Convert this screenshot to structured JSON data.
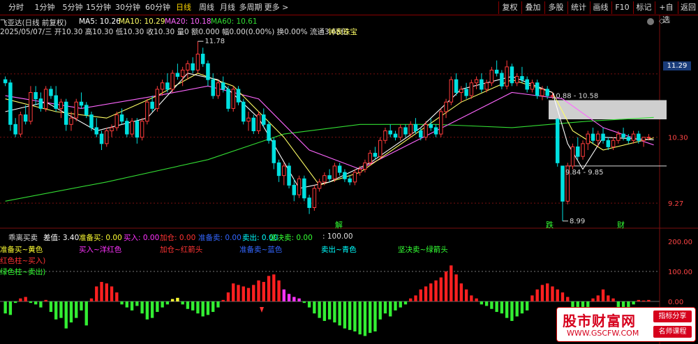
{
  "toolbar": {
    "periods": [
      "分时",
      "1分钟",
      "5分钟",
      "15分钟",
      "30分钟",
      "60分钟",
      "日线",
      "周线",
      "月线",
      "多周期",
      "更多 >"
    ],
    "active_period": "日线",
    "right_buttons": [
      "复权",
      "叠加",
      "多股",
      "统计",
      "画线",
      "F10",
      "标记",
      "+自选",
      "返回"
    ]
  },
  "info": {
    "stock_title": "飞亚达(日线 前复权)",
    "ma5": "MA5: 10.26",
    "ma10": "MA10: 10.29",
    "ma20": "MA20: 10.18",
    "ma60": "MA60: 10.61",
    "date_line": "2025/05/07/三 开10.30 高10.30 低10.30 收10.30 量0 额0.000 幅0.00(0.00%) 换0.00% 流通3.65亿",
    "industry": "钟表珠宝"
  },
  "price_axis": {
    "labels": [
      "11.29",
      "10.30",
      "9.27"
    ]
  },
  "price_annotations": [
    "11.78",
    "10.88 - 10.58",
    "9.84 - 9.85",
    "8.99"
  ],
  "event_markers": [
    "解",
    "跌",
    "财"
  ],
  "indicator": {
    "name": "乖离买卖",
    "chadiff": "差值: 3.40",
    "zhunbeimai": "准备买: 0.00",
    "mairu": "买入: 0.00",
    "jiacang": "加仓: 0.00",
    "zhunbeimai2": "准备卖: 0.00",
    "maichu": "卖出: 0.00",
    "jianjuemai": "坚决卖: 0.00",
    "hundred": ": 100.00",
    "legend": [
      "准备买~黄色",
      "买入~洋红色",
      "加仓~红箭头",
      "准备卖~蓝色",
      "卖出~青色",
      "坚决卖~绿箭头"
    ],
    "legend2": [
      "红色柱~买入)",
      "绿色柱~卖出)"
    ],
    "axis_labels": [
      "200.00",
      "100.00",
      "0.00"
    ]
  },
  "colors": {
    "up": "#ff3b3b",
    "down": "#00e0e0",
    "ma5": "#ffffff",
    "ma10": "#ffff66",
    "ma20": "#ff66ff",
    "ma60": "#33dd33",
    "grid": "#7a1010"
  },
  "watermark": {
    "title": "股市财富网",
    "url": "WWW.GSCFW.COM",
    "tag1": "指标分享",
    "tag2": "名师课程"
  },
  "chart_data": {
    "type": "candlestick",
    "y_range": [
      8.9,
      11.9
    ],
    "candles": [
      [
        11.2,
        11.25,
        11.1,
        11.15
      ],
      [
        11.15,
        11.2,
        10.4,
        10.5
      ],
      [
        10.5,
        10.6,
        10.3,
        10.35
      ],
      [
        10.35,
        10.7,
        10.3,
        10.65
      ],
      [
        10.65,
        10.8,
        10.5,
        10.55
      ],
      [
        10.55,
        11.1,
        10.5,
        11.0
      ],
      [
        11.0,
        11.1,
        10.8,
        10.9
      ],
      [
        10.9,
        11.0,
        10.7,
        10.75
      ],
      [
        10.75,
        11.1,
        10.7,
        11.05
      ],
      [
        11.05,
        11.1,
        10.9,
        10.95
      ],
      [
        10.95,
        11.1,
        10.7,
        10.75
      ],
      [
        10.75,
        10.9,
        10.6,
        10.85
      ],
      [
        10.85,
        10.9,
        10.4,
        10.5
      ],
      [
        10.5,
        10.7,
        10.4,
        10.6
      ],
      [
        10.6,
        10.9,
        10.55,
        10.85
      ],
      [
        10.85,
        11.0,
        10.75,
        10.8
      ],
      [
        10.8,
        10.85,
        10.6,
        10.65
      ],
      [
        10.65,
        10.7,
        10.4,
        10.45
      ],
      [
        10.45,
        10.6,
        10.3,
        10.35
      ],
      [
        10.35,
        10.4,
        10.1,
        10.2
      ],
      [
        10.2,
        10.45,
        10.15,
        10.4
      ],
      [
        10.4,
        10.5,
        10.3,
        10.45
      ],
      [
        10.45,
        10.7,
        10.4,
        10.65
      ],
      [
        10.65,
        10.75,
        10.5,
        10.55
      ],
      [
        10.55,
        10.6,
        10.3,
        10.35
      ],
      [
        10.35,
        10.6,
        10.3,
        10.55
      ],
      [
        10.55,
        10.6,
        10.2,
        10.3
      ],
      [
        10.3,
        10.6,
        10.25,
        10.55
      ],
      [
        10.55,
        10.9,
        10.5,
        10.85
      ],
      [
        10.85,
        10.95,
        10.7,
        10.75
      ],
      [
        10.75,
        11.1,
        10.7,
        11.05
      ],
      [
        11.05,
        11.2,
        10.95,
        11.15
      ],
      [
        11.15,
        11.3,
        11.0,
        11.05
      ],
      [
        11.05,
        11.35,
        11.0,
        11.3
      ],
      [
        11.3,
        11.45,
        11.2,
        11.25
      ],
      [
        11.25,
        11.4,
        11.1,
        11.35
      ],
      [
        11.35,
        11.5,
        11.2,
        11.45
      ],
      [
        11.45,
        11.55,
        11.3,
        11.35
      ],
      [
        11.35,
        11.8,
        11.3,
        11.6
      ],
      [
        11.6,
        11.7,
        11.4,
        11.45
      ],
      [
        11.45,
        11.5,
        11.1,
        11.2
      ],
      [
        11.2,
        11.3,
        10.9,
        10.95
      ],
      [
        10.95,
        11.2,
        10.9,
        11.15
      ],
      [
        11.15,
        11.25,
        11.0,
        11.05
      ],
      [
        11.05,
        11.1,
        10.7,
        10.75
      ],
      [
        10.75,
        11.1,
        10.7,
        11.05
      ],
      [
        11.05,
        11.1,
        10.8,
        10.85
      ],
      [
        10.85,
        10.9,
        10.5,
        10.55
      ],
      [
        10.55,
        10.7,
        10.4,
        10.6
      ],
      [
        10.6,
        10.65,
        10.35,
        10.4
      ],
      [
        10.4,
        10.7,
        10.35,
        10.65
      ],
      [
        10.65,
        10.75,
        10.45,
        10.5
      ],
      [
        10.5,
        10.55,
        10.2,
        10.25
      ],
      [
        10.25,
        10.3,
        9.8,
        9.9
      ],
      [
        9.9,
        9.95,
        9.6,
        9.7
      ],
      [
        9.7,
        9.9,
        9.55,
        9.85
      ],
      [
        9.85,
        9.9,
        9.5,
        9.55
      ],
      [
        9.55,
        9.65,
        9.3,
        9.4
      ],
      [
        9.4,
        9.7,
        9.35,
        9.65
      ],
      [
        9.65,
        9.7,
        9.3,
        9.35
      ],
      [
        9.35,
        9.4,
        9.1,
        9.2
      ],
      [
        9.2,
        9.55,
        9.15,
        9.5
      ],
      [
        9.5,
        9.65,
        9.45,
        9.6
      ],
      [
        9.6,
        9.75,
        9.55,
        9.7
      ],
      [
        9.7,
        9.8,
        9.6,
        9.65
      ],
      [
        9.65,
        9.9,
        9.6,
        9.85
      ],
      [
        9.85,
        9.9,
        9.7,
        9.75
      ],
      [
        9.75,
        9.8,
        9.6,
        9.65
      ],
      [
        9.65,
        9.7,
        9.55,
        9.6
      ],
      [
        9.6,
        9.8,
        9.55,
        9.75
      ],
      [
        9.75,
        9.85,
        9.7,
        9.8
      ],
      [
        9.8,
        9.95,
        9.75,
        9.9
      ],
      [
        9.9,
        10.1,
        9.85,
        10.05
      ],
      [
        10.05,
        10.15,
        9.95,
        10.0
      ],
      [
        10.0,
        10.3,
        9.95,
        10.25
      ],
      [
        10.25,
        10.45,
        10.2,
        10.4
      ],
      [
        10.4,
        10.5,
        10.3,
        10.35
      ],
      [
        10.35,
        10.4,
        10.25,
        10.3
      ],
      [
        10.3,
        10.5,
        10.25,
        10.45
      ],
      [
        10.45,
        10.5,
        10.3,
        10.35
      ],
      [
        10.35,
        10.55,
        10.3,
        10.5
      ],
      [
        10.5,
        10.6,
        10.35,
        10.4
      ],
      [
        10.4,
        10.45,
        10.25,
        10.3
      ],
      [
        10.3,
        10.55,
        10.25,
        10.5
      ],
      [
        10.5,
        10.6,
        10.4,
        10.45
      ],
      [
        10.45,
        10.5,
        10.3,
        10.35
      ],
      [
        10.35,
        10.75,
        10.3,
        10.7
      ],
      [
        10.7,
        10.9,
        10.6,
        10.85
      ],
      [
        10.85,
        11.25,
        10.8,
        11.2
      ],
      [
        11.2,
        11.3,
        10.95,
        11.0
      ],
      [
        11.0,
        11.1,
        10.85,
        11.05
      ],
      [
        11.05,
        11.15,
        10.9,
        10.95
      ],
      [
        10.95,
        11.2,
        10.9,
        11.15
      ],
      [
        11.15,
        11.25,
        11.05,
        11.2
      ],
      [
        11.2,
        11.3,
        11.0,
        11.05
      ],
      [
        11.05,
        11.2,
        11.0,
        11.15
      ],
      [
        11.15,
        11.4,
        11.1,
        11.35
      ],
      [
        11.35,
        11.5,
        11.25,
        11.3
      ],
      [
        11.3,
        11.35,
        11.05,
        11.1
      ],
      [
        11.1,
        11.5,
        11.05,
        11.4
      ],
      [
        11.4,
        11.45,
        11.1,
        11.15
      ],
      [
        11.15,
        11.3,
        11.1,
        11.25
      ],
      [
        11.25,
        11.4,
        11.15,
        11.2
      ],
      [
        11.2,
        11.25,
        11.0,
        11.05
      ],
      [
        11.05,
        11.2,
        11.0,
        11.15
      ],
      [
        11.15,
        11.2,
        10.9,
        10.95
      ],
      [
        10.95,
        11.1,
        10.88,
        11.05
      ],
      [
        11.05,
        11.1,
        10.9,
        10.95
      ],
      [
        10.95,
        11.0,
        10.9,
        10.95
      ],
      [
        10.58,
        10.6,
        9.84,
        9.9
      ],
      [
        9.85,
        9.85,
        8.99,
        9.3
      ],
      [
        9.3,
        9.9,
        9.25,
        9.85
      ],
      [
        9.85,
        10.2,
        9.8,
        10.15
      ],
      [
        10.15,
        10.3,
        9.95,
        10.0
      ],
      [
        10.0,
        10.25,
        9.95,
        10.2
      ],
      [
        10.2,
        10.4,
        10.1,
        10.35
      ],
      [
        10.35,
        10.45,
        10.2,
        10.25
      ],
      [
        10.25,
        10.4,
        10.15,
        10.35
      ],
      [
        10.35,
        10.45,
        10.2,
        10.25
      ],
      [
        10.25,
        10.3,
        10.1,
        10.15
      ],
      [
        10.15,
        10.3,
        10.1,
        10.25
      ],
      [
        10.25,
        10.4,
        10.2,
        10.35
      ],
      [
        10.35,
        10.45,
        10.25,
        10.3
      ],
      [
        10.3,
        10.35,
        10.2,
        10.25
      ],
      [
        10.25,
        10.4,
        10.2,
        10.35
      ],
      [
        10.35,
        10.4,
        10.2,
        10.25
      ],
      [
        10.25,
        10.3,
        10.15,
        10.3
      ],
      [
        10.3,
        10.35,
        10.25,
        10.3
      ]
    ],
    "ma60": [
      [
        0,
        9.3
      ],
      [
        20,
        9.6
      ],
      [
        40,
        9.95
      ],
      [
        55,
        10.35
      ],
      [
        70,
        10.5
      ],
      [
        85,
        10.5
      ],
      [
        100,
        10.45
      ],
      [
        115,
        10.55
      ],
      [
        128,
        10.61
      ]
    ],
    "ma20": [
      [
        0,
        10.95
      ],
      [
        15,
        10.75
      ],
      [
        30,
        10.95
      ],
      [
        40,
        11.1
      ],
      [
        50,
        10.9
      ],
      [
        60,
        10.1
      ],
      [
        70,
        9.8
      ],
      [
        80,
        10.2
      ],
      [
        90,
        10.6
      ],
      [
        100,
        11.0
      ],
      [
        110,
        10.9
      ],
      [
        118,
        10.45
      ],
      [
        128,
        10.18
      ]
    ],
    "ma10": [
      [
        0,
        10.9
      ],
      [
        10,
        10.7
      ],
      [
        20,
        10.6
      ],
      [
        30,
        10.95
      ],
      [
        38,
        11.3
      ],
      [
        45,
        11.1
      ],
      [
        55,
        10.3
      ],
      [
        62,
        9.55
      ],
      [
        70,
        9.75
      ],
      [
        80,
        10.3
      ],
      [
        90,
        10.85
      ],
      [
        100,
        11.2
      ],
      [
        108,
        11.0
      ],
      [
        112,
        10.4
      ],
      [
        118,
        10.1
      ],
      [
        128,
        10.29
      ]
    ],
    "ma5": [
      [
        0,
        10.7
      ],
      [
        8,
        10.85
      ],
      [
        18,
        10.4
      ],
      [
        28,
        10.6
      ],
      [
        36,
        11.3
      ],
      [
        42,
        11.2
      ],
      [
        50,
        10.6
      ],
      [
        58,
        9.5
      ],
      [
        64,
        9.6
      ],
      [
        72,
        9.9
      ],
      [
        82,
        10.45
      ],
      [
        90,
        11.05
      ],
      [
        100,
        11.25
      ],
      [
        108,
        11.0
      ],
      [
        111,
        10.2
      ],
      [
        114,
        9.8
      ],
      [
        118,
        10.3
      ],
      [
        128,
        10.26
      ]
    ],
    "indicator_bars": [
      -40,
      -45,
      -5,
      10,
      15,
      -5,
      -10,
      -20,
      5,
      -35,
      -60,
      -55,
      -90,
      -70,
      -55,
      -30,
      -80,
      10,
      50,
      65,
      60,
      50,
      30,
      -10,
      -20,
      -30,
      -15,
      -40,
      -60,
      -55,
      -35,
      -20,
      -10,
      8,
      12,
      -10,
      -25,
      -30,
      -40,
      -50,
      -45,
      -35,
      -20,
      5,
      30,
      60,
      55,
      50,
      45,
      55,
      70,
      65,
      85,
      90,
      70,
      40,
      25,
      15,
      10,
      -5,
      -20,
      -40,
      -55,
      -65,
      -60,
      -70,
      -80,
      -90,
      -95,
      -100,
      -110,
      -115,
      -105,
      -100,
      -60,
      -40,
      -50,
      -30,
      -20,
      -10,
      10,
      20,
      40,
      50,
      60,
      70,
      80,
      100,
      120,
      90,
      60,
      40,
      20,
      10,
      -10,
      -15,
      -25,
      -35,
      -40,
      -55,
      -65,
      -50,
      -40,
      -30,
      20,
      40,
      55,
      60,
      50,
      40,
      30,
      15,
      -60,
      -110,
      -50,
      -40,
      10,
      20,
      40,
      20,
      10,
      -20,
      -30,
      -20,
      -10,
      5,
      3,
      5
    ]
  }
}
